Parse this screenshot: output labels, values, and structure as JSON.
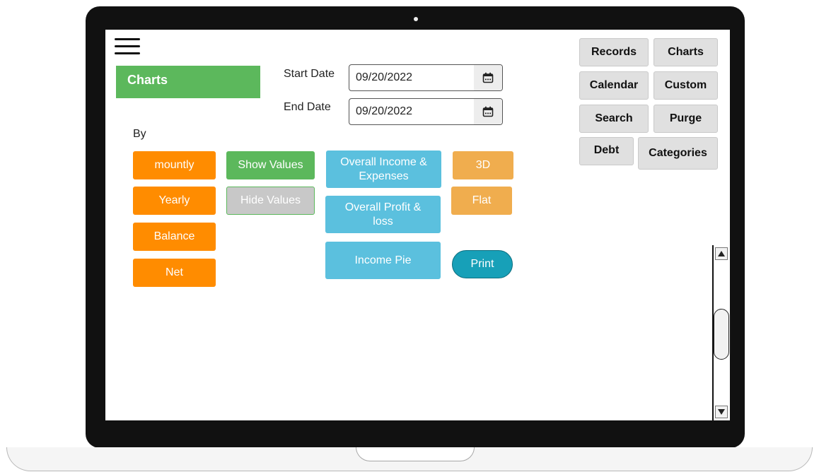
{
  "header": {
    "title": "Charts"
  },
  "dates": {
    "start_label": "Start Date",
    "start_value": "09/20/2022",
    "end_label": "End Date",
    "end_value": "09/20/2022",
    "icon": "calendar-icon"
  },
  "by_label": "By",
  "period_buttons": [
    "mountly",
    "Yearly",
    "Balance",
    "Net"
  ],
  "value_buttons": {
    "show": "Show Values",
    "hide": "Hide Values"
  },
  "chart_buttons": {
    "overall_income": "Overall Income & Expenses",
    "overall_profit": "Overall Profit & loss",
    "income_pie": "Income Pie"
  },
  "view_buttons": {
    "three_d": "3D",
    "flat": "Flat",
    "print": "Print"
  },
  "nav": {
    "records": "Records",
    "charts": "Charts",
    "calendar": "Calendar",
    "custom": "Custom",
    "search": "Search",
    "purge": "Purge",
    "debt": "Debt",
    "categories": "Categories"
  },
  "colors": {
    "green": "#5cb85c",
    "orange": "#ff8c00",
    "blue": "#5bc0de",
    "light_orange": "#f0ad4e",
    "print_teal": "#17a0b8",
    "nav_grey": "#e0e0e0"
  },
  "icons": [
    "menu-icon",
    "calendar-icon",
    "scroll-up-arrow-icon",
    "scroll-down-arrow-icon"
  ]
}
